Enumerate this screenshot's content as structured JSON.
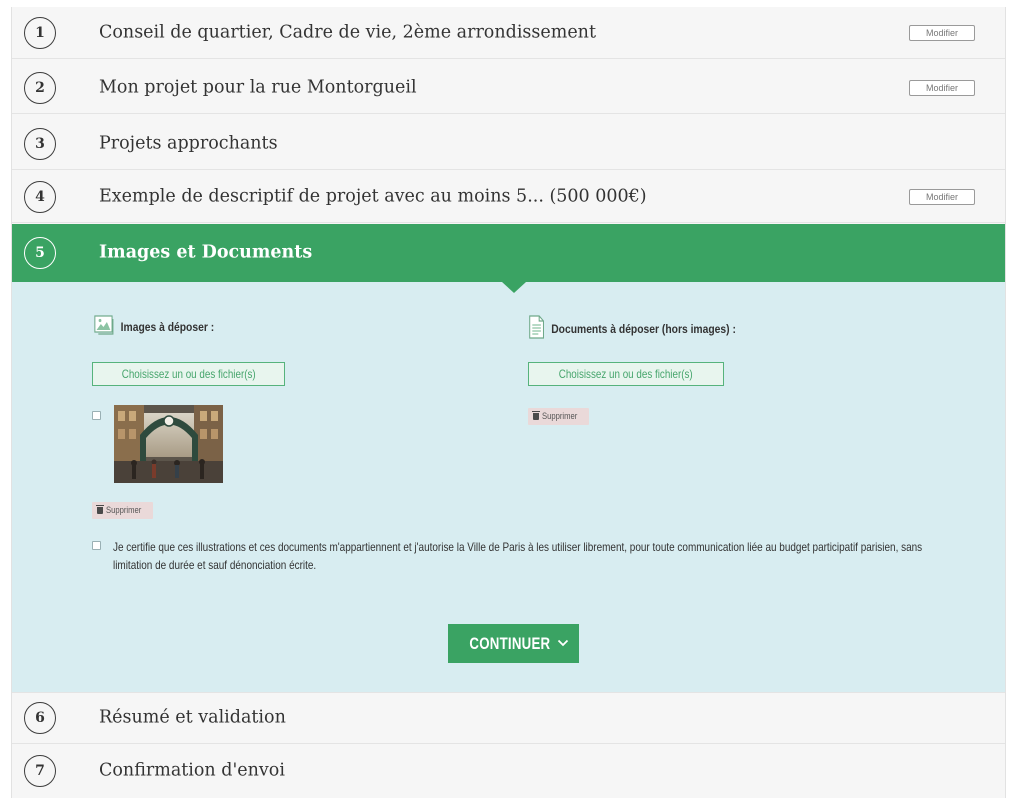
{
  "steps": [
    {
      "number": "1",
      "title": "Conseil de quartier, Cadre de vie, 2ème arrondissement",
      "modify_label": "Modifier"
    },
    {
      "number": "2",
      "title": "Mon projet pour la rue Montorgueil",
      "modify_label": "Modifier"
    },
    {
      "number": "3",
      "title": "Projets approchants"
    },
    {
      "number": "4",
      "title": "Exemple de descriptif de projet avec au moins 5... (500 000€)",
      "modify_label": "Modifier"
    },
    {
      "number": "5",
      "title": "Images et Documents"
    },
    {
      "number": "6",
      "title": "Résumé et validation"
    },
    {
      "number": "7",
      "title": "Confirmation d'envoi"
    }
  ],
  "images_section": {
    "label": "Images à déposer :",
    "choose_label": "Choisissez un ou des fichier(s)",
    "delete_label": "Supprimer",
    "icon": "image-file-icon"
  },
  "documents_section": {
    "label": "Documents à déposer (hors images) :",
    "choose_label": "Choisissez un ou des fichier(s)",
    "delete_label": "Supprimer",
    "icon": "document-file-icon"
  },
  "certification_text": "Je certifie que ces illustrations et ces documents m'appartiennent et j'autorise la Ville de Paris à les utiliser librement, pour toute communication liée au budget participatif parisien, sans limitation de durée et sauf dénonciation écrite.",
  "continue_label": "CONTINUER",
  "colors": {
    "accent_green": "#3aa363",
    "panel_blue": "#d8edf1",
    "row_gray": "#f6f6f6"
  }
}
